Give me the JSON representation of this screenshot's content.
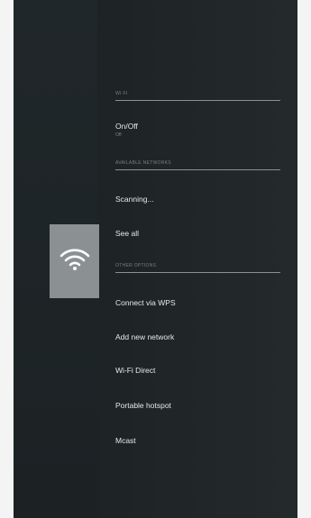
{
  "wifi_tile": {
    "icon": "wifi-icon"
  },
  "sections": {
    "wifi": {
      "header": "WI-FI"
    },
    "available": {
      "header": "AVAILABLE NETWORKS"
    },
    "other": {
      "header": "OTHER OPTIONS"
    }
  },
  "items": {
    "onoff": {
      "label": "On/Off",
      "sub": "Off"
    },
    "scanning": {
      "label": "Scanning..."
    },
    "see_all": {
      "label": "See all"
    },
    "wps": {
      "label": "Connect via WPS"
    },
    "add_network": {
      "label": "Add new network"
    },
    "wifi_direct": {
      "label": "Wi-Fi Direct"
    },
    "hotspot": {
      "label": "Portable hotspot"
    },
    "mcast": {
      "label": "Mcast"
    }
  },
  "colors": {
    "background": "#1e2325",
    "tile": "#8b9092",
    "text": "#e6e9ea",
    "divider": "#8a9193"
  }
}
